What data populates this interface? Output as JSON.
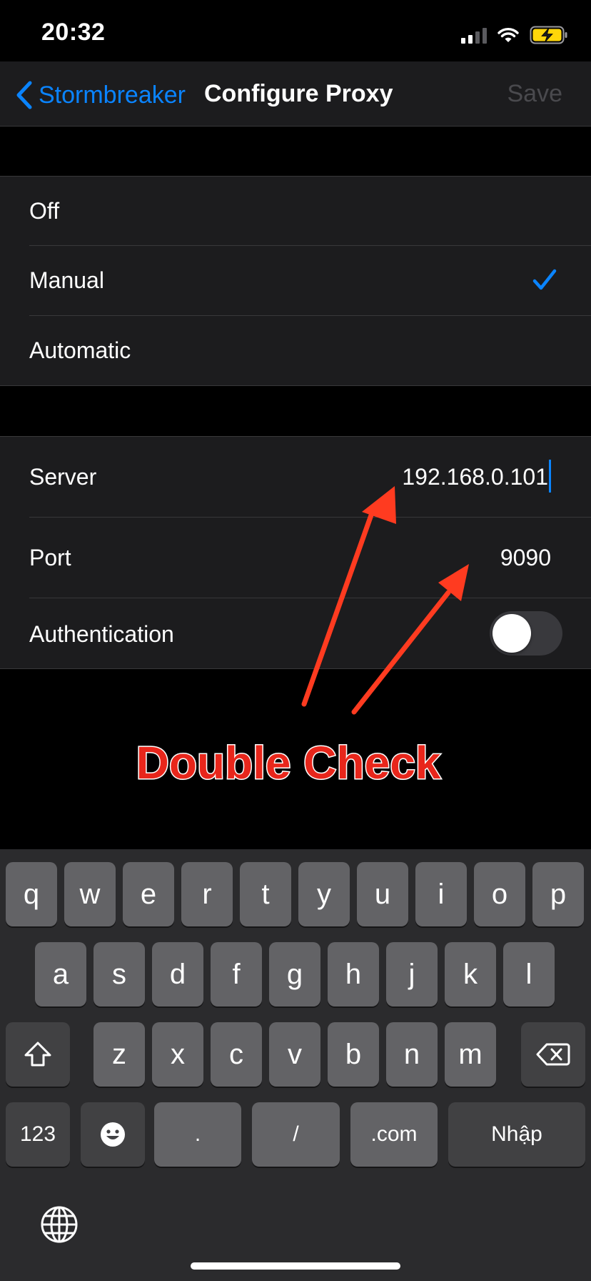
{
  "status": {
    "time": "20:32"
  },
  "nav": {
    "back_label": "Stormbreaker",
    "title": "Configure Proxy",
    "save_label": "Save"
  },
  "proxy_mode": {
    "options": [
      "Off",
      "Manual",
      "Automatic"
    ],
    "selected": "Manual",
    "accent": "#0a84ff"
  },
  "settings": {
    "server_label": "Server",
    "server_value": "192.168.0.101",
    "port_label": "Port",
    "port_value": "9090",
    "auth_label": "Authentication",
    "auth_enabled": false
  },
  "annotation": {
    "text": "Double Check",
    "color": "#e8261b"
  },
  "keyboard": {
    "row1": [
      "q",
      "w",
      "e",
      "r",
      "t",
      "y",
      "u",
      "i",
      "o",
      "p"
    ],
    "row2": [
      "a",
      "s",
      "d",
      "f",
      "g",
      "h",
      "j",
      "k",
      "l"
    ],
    "row3": [
      "z",
      "x",
      "c",
      "v",
      "b",
      "n",
      "m"
    ],
    "numbers_key": "123",
    "dot_key": ".",
    "slash_key": "/",
    "dotcom_key": ".com",
    "return_key": "Nhập",
    "icons": [
      "shift-icon",
      "backspace-icon",
      "emoji-icon",
      "globe-icon"
    ]
  }
}
